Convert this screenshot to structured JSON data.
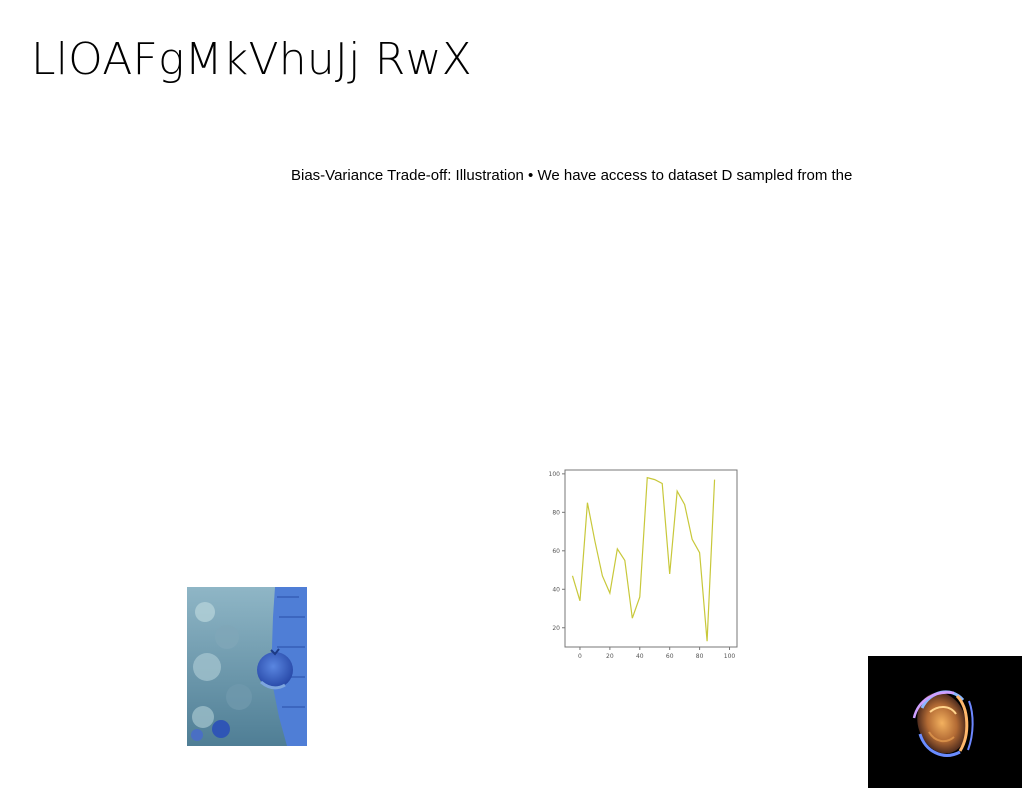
{
  "slide": {
    "title": "LlOAFgMkVhuJj RwX",
    "subtitle": "Bias-Variance Trade-off: Illustration • We have access to dataset D sampled from the"
  },
  "chart_data": {
    "type": "line",
    "x": [
      -5,
      0,
      5,
      10,
      15,
      20,
      25,
      30,
      35,
      40,
      45,
      50,
      55,
      60,
      65,
      70,
      75,
      80,
      85,
      90,
      95,
      100
    ],
    "series": [
      {
        "values": [
          47,
          34,
          85,
          65,
          47,
          38,
          61,
          55,
          25,
          36,
          98,
          97,
          95,
          48,
          91,
          84,
          66,
          59,
          13,
          97
        ]
      }
    ],
    "xticks": [
      "0",
      "20",
      "40",
      "60",
      "80",
      "100"
    ],
    "yticks": [
      "20",
      "40",
      "60",
      "80",
      "100"
    ],
    "xlim": [
      -10,
      105
    ],
    "ylim": [
      10,
      102
    ],
    "line_color": "#c8c83a",
    "grid": false
  },
  "images": {
    "left_photo": "person-holding-blue-fruit-photo",
    "right_photo": "abstract-swirl-on-black-photo"
  }
}
